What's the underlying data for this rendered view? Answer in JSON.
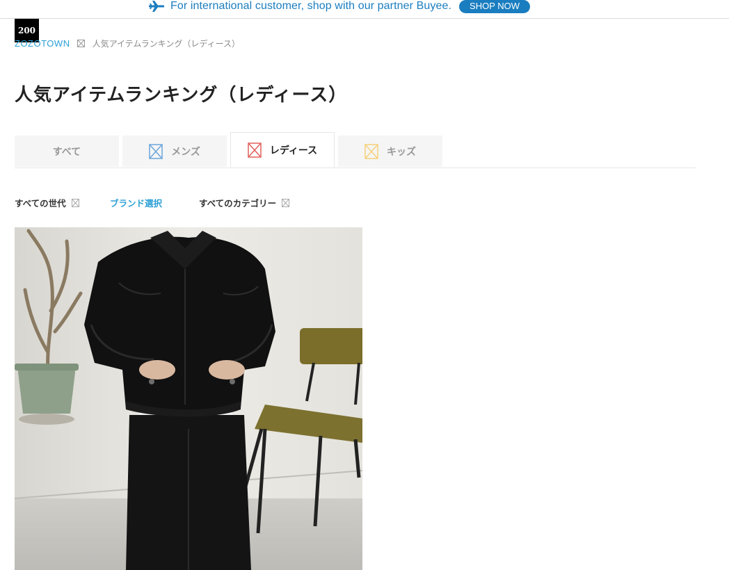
{
  "banner": {
    "text": "For international customer, shop with our partner Buyee.",
    "button_label": "SHOP NOW"
  },
  "badge": {
    "text": "200"
  },
  "breadcrumb": {
    "home": "ZOZOTOWN",
    "current": "人気アイテムランキング（レディース）"
  },
  "page": {
    "title": "人気アイテムランキング（レディース）"
  },
  "tabs": [
    {
      "label": "すべて",
      "icon": "none",
      "active": false
    },
    {
      "label": "メンズ",
      "icon": "men-icon",
      "active": false
    },
    {
      "label": "レディース",
      "icon": "women-icon",
      "active": true
    },
    {
      "label": "キッズ",
      "icon": "kids-icon",
      "active": false
    }
  ],
  "filters": {
    "generation": "すべての世代",
    "brand": "ブランド選択",
    "category": "すべてのカテゴリー"
  },
  "colors": {
    "link": "#2a9fd6",
    "banner": "#1a7dc0",
    "men_icon": "#6aa5dc",
    "women_icon": "#e0605a",
    "kids_icon": "#f5d17a"
  },
  "product": {
    "image": "black leather jacket outfit photo"
  }
}
